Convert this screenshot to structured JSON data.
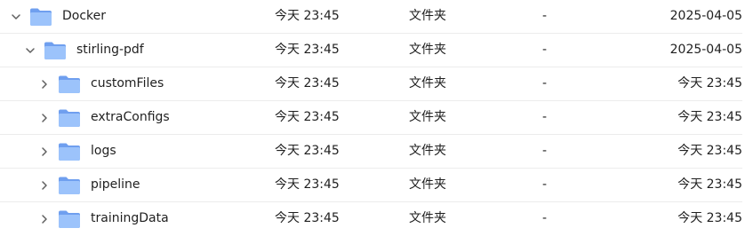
{
  "rows": [
    {
      "name": "Docker",
      "modified": "今天 23:45",
      "type": "文件夹",
      "size": "-",
      "created": "2025-04-05"
    },
    {
      "name": "stirling-pdf",
      "modified": "今天 23:45",
      "type": "文件夹",
      "size": "-",
      "created": "2025-04-05"
    },
    {
      "name": "customFiles",
      "modified": "今天 23:45",
      "type": "文件夹",
      "size": "-",
      "created": "今天 23:45"
    },
    {
      "name": "extraConfigs",
      "modified": "今天 23:45",
      "type": "文件夹",
      "size": "-",
      "created": "今天 23:45"
    },
    {
      "name": "logs",
      "modified": "今天 23:45",
      "type": "文件夹",
      "size": "-",
      "created": "今天 23:45"
    },
    {
      "name": "pipeline",
      "modified": "今天 23:45",
      "type": "文件夹",
      "size": "-",
      "created": "今天 23:45"
    },
    {
      "name": "trainingData",
      "modified": "今天 23:45",
      "type": "文件夹",
      "size": "-",
      "created": "今天 23:45"
    }
  ],
  "colors": {
    "folder_back": "#6f9fef",
    "folder_front": "#9cc3fb",
    "chevron": "#5f5f5f"
  },
  "icons": {
    "expanded": "chevron-down-icon",
    "collapsed": "chevron-right-icon",
    "folder": "folder-icon"
  }
}
